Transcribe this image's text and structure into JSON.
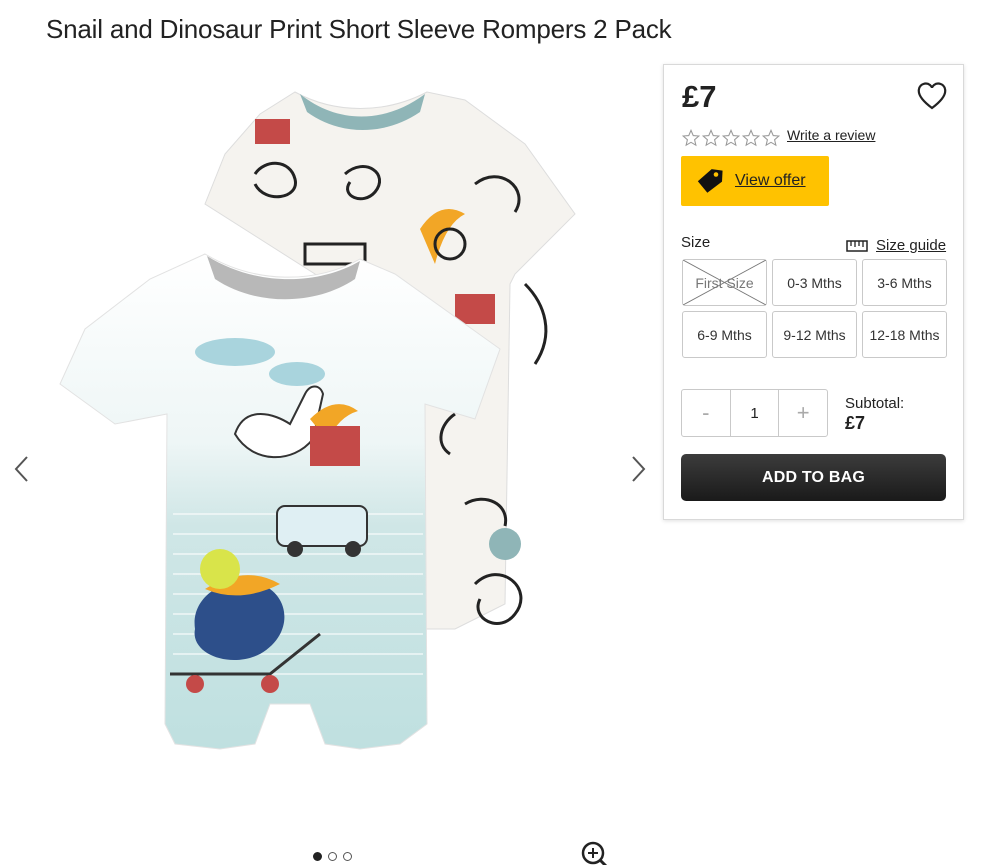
{
  "product": {
    "title": "Snail and Dinosaur Print Short Sleeve Rompers 2 Pack",
    "price": "£7"
  },
  "gallery": {
    "prev_icon": "chevron-left-icon",
    "next_icon": "chevron-right-icon",
    "zoom_icon": "zoom-in-icon",
    "dots": [
      {
        "active": true
      },
      {
        "active": false
      },
      {
        "active": false
      }
    ]
  },
  "rating": {
    "stars": 0,
    "max": 5,
    "review_link": "Write a review"
  },
  "offer": {
    "label": "View offer",
    "color": "#ffc200"
  },
  "size": {
    "label": "Size",
    "guide_label": "Size guide",
    "options": [
      {
        "label": "First Size",
        "available": false
      },
      {
        "label": "0-3 Mths",
        "available": true
      },
      {
        "label": "3-6 Mths",
        "available": true
      },
      {
        "label": "6-9 Mths",
        "available": true
      },
      {
        "label": "9-12 Mths",
        "available": true
      },
      {
        "label": "12-18 Mths",
        "available": true
      }
    ]
  },
  "quantity": {
    "minus": "-",
    "value": "1",
    "plus": "+"
  },
  "subtotal": {
    "label": "Subtotal:",
    "value": "£7"
  },
  "add_to_bag": {
    "label": "ADD TO BAG"
  }
}
